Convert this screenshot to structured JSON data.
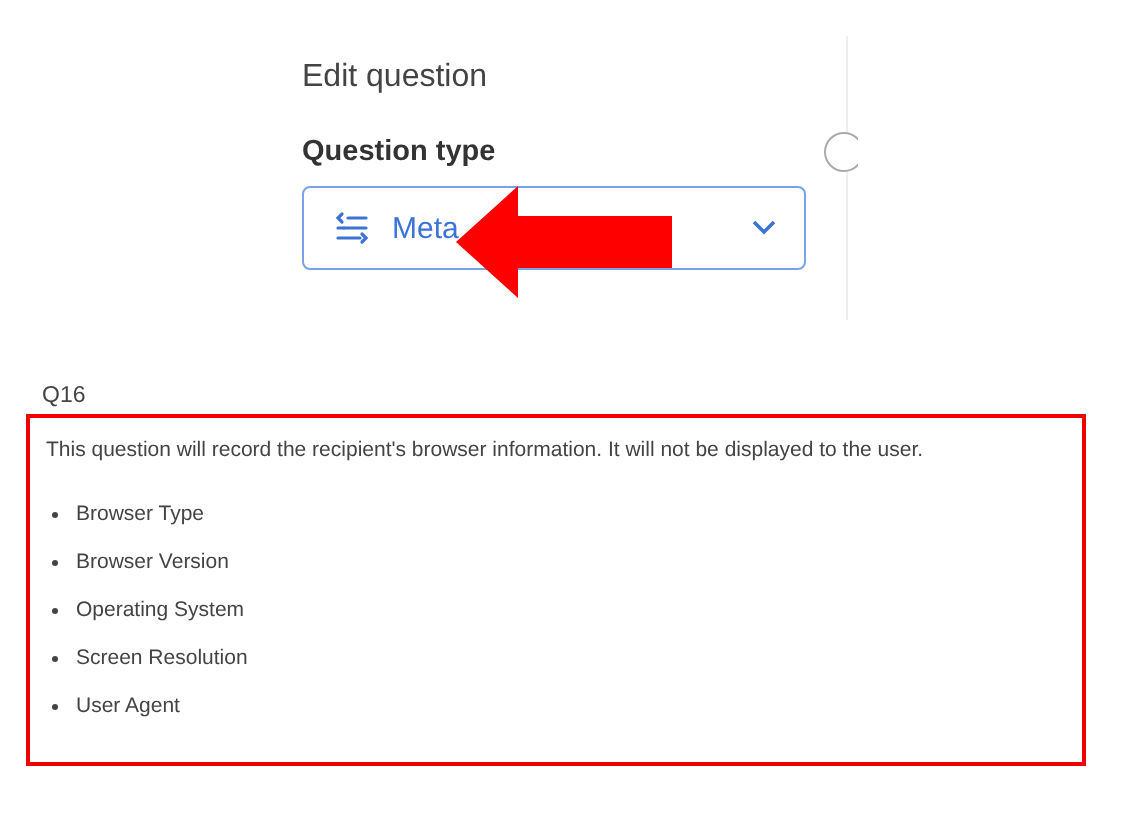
{
  "panel": {
    "title": "Edit question",
    "field_label": "Question type",
    "dropdown": {
      "value": "Meta"
    }
  },
  "question": {
    "number": "Q16",
    "description": "This question will record the recipient's browser information. It will not be displayed to the user.",
    "items": [
      "Browser Type",
      "Browser Version",
      "Operating System",
      "Screen Resolution",
      "User Agent"
    ]
  }
}
